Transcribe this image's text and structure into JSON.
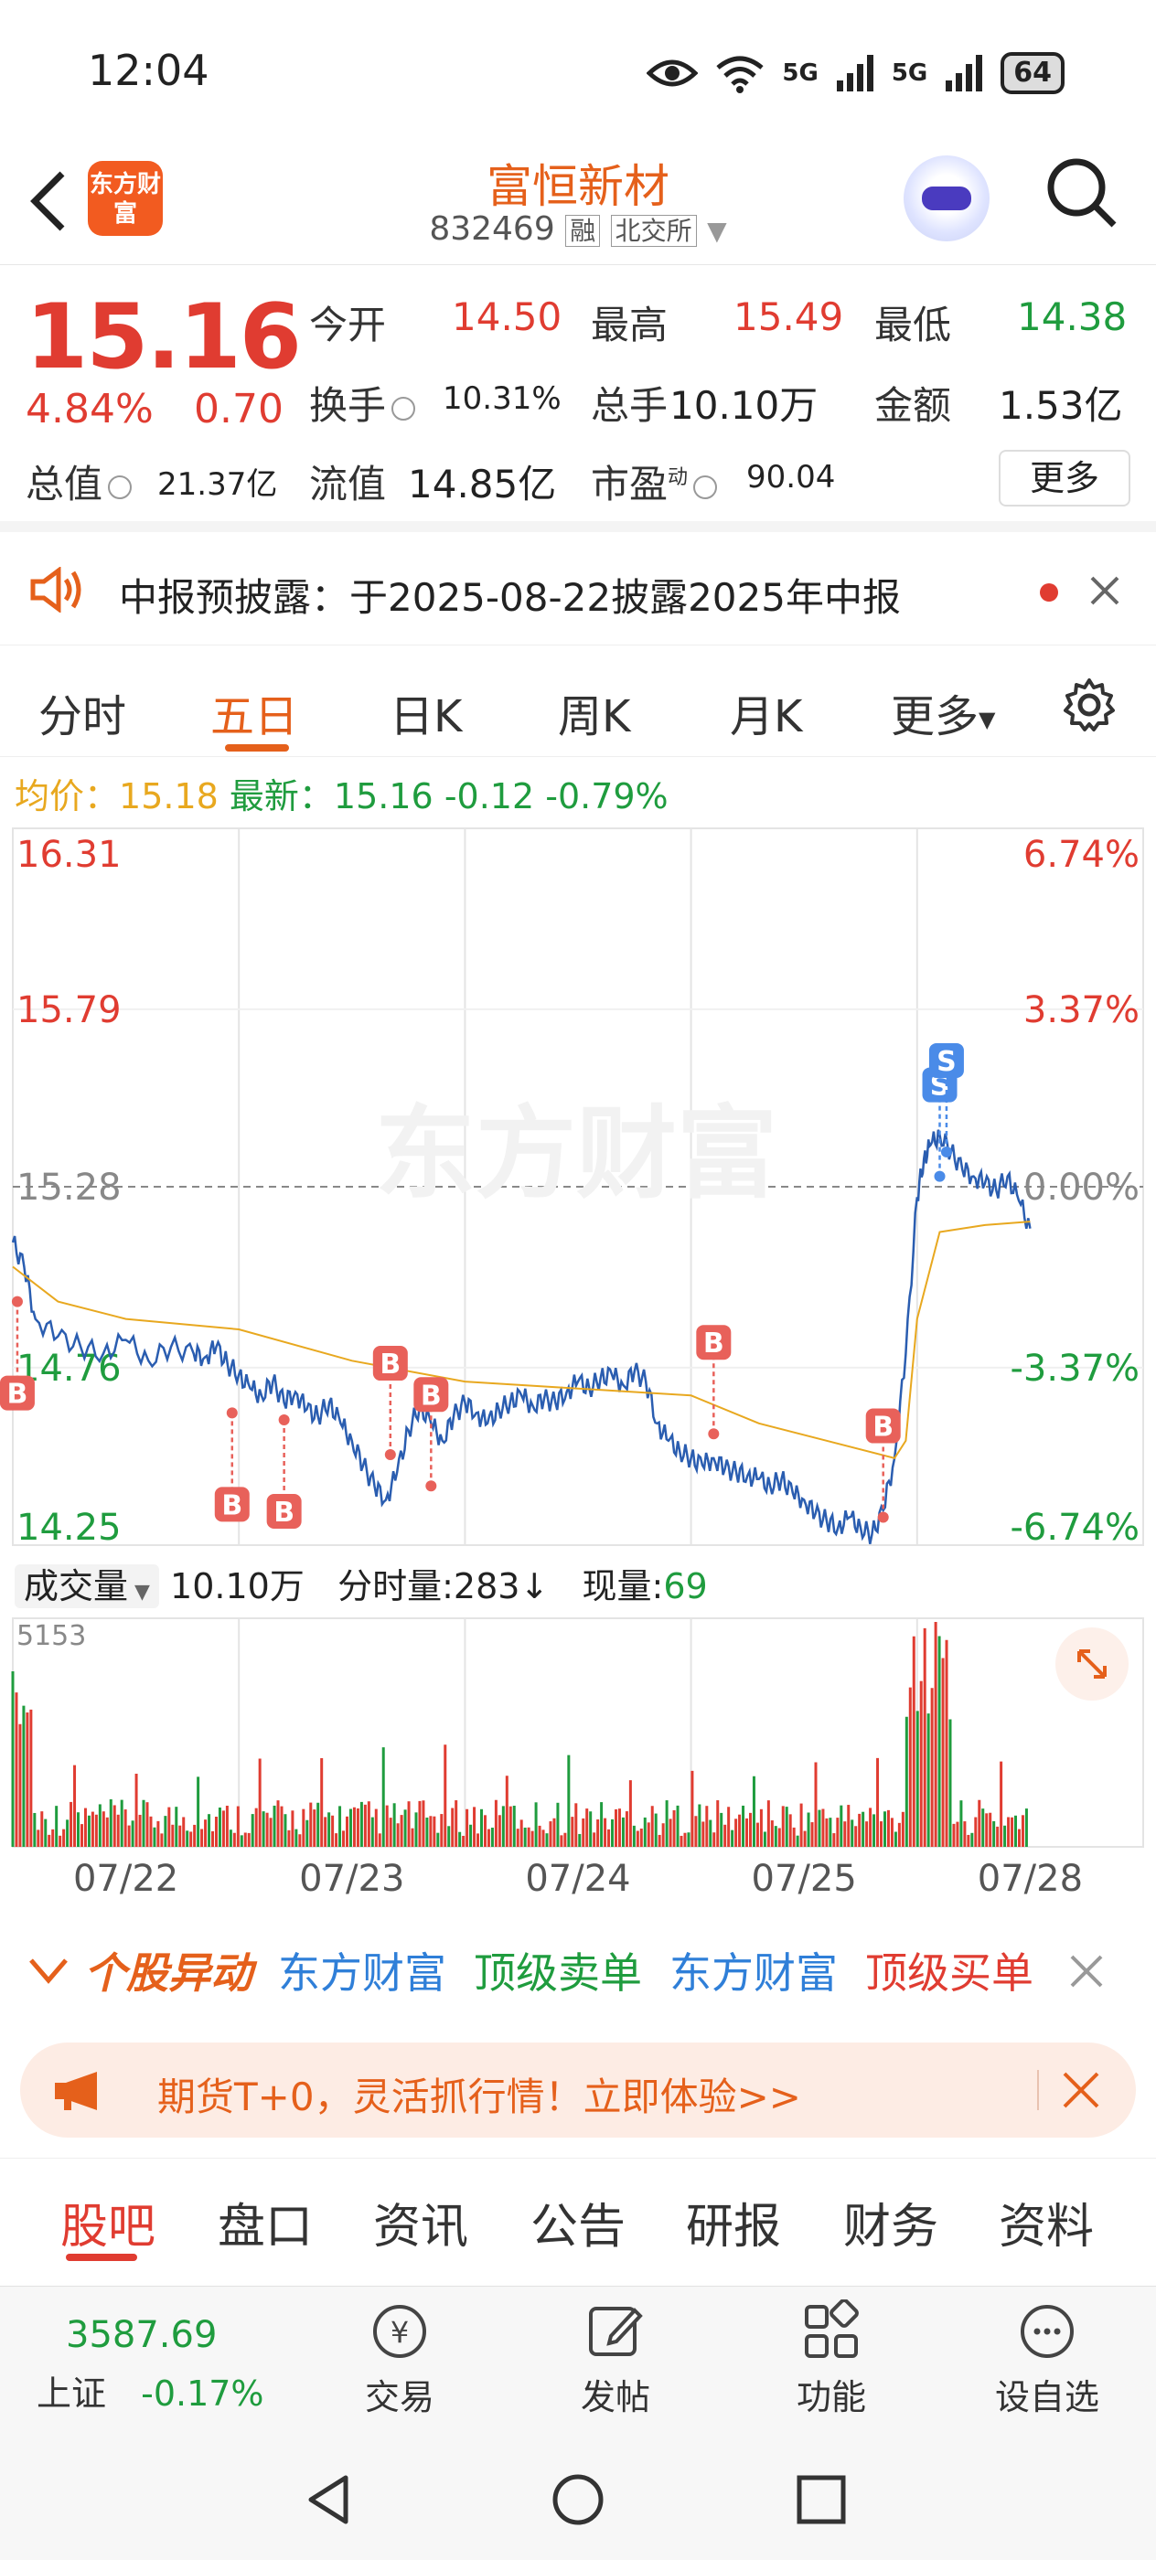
{
  "status_bar": {
    "time": "12:04",
    "network1": "5G",
    "network2": "5G",
    "battery": "64"
  },
  "header": {
    "logo_text": "东方财富",
    "title": "富恒新材",
    "code": "832469",
    "tag_margin": "融",
    "tag_exchange": "北交所"
  },
  "quote": {
    "price": "15.16",
    "change_pct": "4.84%",
    "change": "0.70",
    "open_label": "今开",
    "open": "14.50",
    "high_label": "最高",
    "high": "15.49",
    "low_label": "最低",
    "low": "14.38",
    "turnover_label": "换手",
    "turnover": "10.31%",
    "volume_label": "总手",
    "volume": "10.10万",
    "amount_label": "金额",
    "amount": "1.53亿",
    "mktcap_label": "总值",
    "mktcap": "21.37亿",
    "float_label": "流值",
    "float_cap": "14.85亿",
    "pe_label": "市盈",
    "pe_sup": "动",
    "pe": "90.04",
    "more": "更多"
  },
  "notice": {
    "text": "中报预披露：于2025-08-22披露2025年中报"
  },
  "chart_tabs": [
    "分时",
    "五日",
    "日K",
    "周K",
    "月K",
    "更多"
  ],
  "active_chart_tab": "五日",
  "avg_line": {
    "avg_label": "均价：",
    "avg": "15.18",
    "latest_label": "最新：",
    "latest": "15.16",
    "chg": "-0.12",
    "chg_pct": "-0.79%"
  },
  "chart_data": {
    "type": "line",
    "title": "",
    "y_left_ticks": [
      "16.31",
      "15.79",
      "15.28",
      "14.76",
      "14.25"
    ],
    "y_right_ticks": [
      "6.74%",
      "3.37%",
      "0.00%",
      "-3.37%",
      "-6.74%"
    ],
    "x_ticks": [
      "07/22",
      "07/23",
      "07/24",
      "07/25",
      "07/28"
    ],
    "ylim": [
      14.25,
      16.31
    ],
    "prev_close": 15.28,
    "watermark": "东方财富",
    "series": [
      {
        "name": "price",
        "color": "#2a5db0",
        "x": [
          0,
          0.05,
          0.1,
          0.2,
          0.3,
          0.4,
          0.5,
          0.6,
          0.7,
          0.8,
          0.85,
          0.9,
          0.95,
          1,
          1.05,
          1.1,
          1.15,
          1.2,
          1.25,
          1.3,
          1.35,
          1.4,
          1.45,
          1.5,
          1.55,
          1.6,
          1.65,
          1.7,
          1.75,
          1.8,
          1.85,
          1.9,
          1.95,
          2,
          2.05,
          2.1,
          2.15,
          2.2,
          2.25,
          2.3,
          2.35,
          2.4,
          2.45,
          2.5,
          2.55,
          2.6,
          2.65,
          2.7,
          2.75,
          2.8,
          2.85,
          2.9,
          2.95,
          3,
          3.05,
          3.1,
          3.15,
          3.2,
          3.25,
          3.3,
          3.35,
          3.4,
          3.45,
          3.5,
          3.55,
          3.6,
          3.65,
          3.7,
          3.75,
          3.8,
          3.85,
          3.9,
          3.95,
          4,
          4.03,
          4.06,
          4.1,
          4.15,
          4.2,
          4.25,
          4.3,
          4.35,
          4.4,
          4.45,
          4.5
        ],
        "values": [
          15.12,
          15.05,
          14.9,
          14.85,
          14.82,
          14.8,
          14.84,
          14.78,
          14.82,
          14.8,
          14.79,
          14.82,
          14.77,
          14.74,
          14.7,
          14.68,
          14.72,
          14.66,
          14.69,
          14.64,
          14.62,
          14.66,
          14.6,
          14.55,
          14.48,
          14.42,
          14.38,
          14.46,
          14.58,
          14.65,
          14.6,
          14.55,
          14.62,
          14.66,
          14.63,
          14.6,
          14.64,
          14.66,
          14.68,
          14.65,
          14.67,
          14.66,
          14.69,
          14.72,
          14.7,
          14.73,
          14.74,
          14.71,
          14.75,
          14.72,
          14.6,
          14.55,
          14.52,
          14.5,
          14.48,
          14.5,
          14.47,
          14.46,
          14.45,
          14.44,
          14.42,
          14.44,
          14.4,
          14.38,
          14.34,
          14.32,
          14.3,
          14.33,
          14.3,
          14.28,
          14.35,
          14.5,
          14.8,
          15.25,
          15.36,
          15.4,
          15.43,
          15.38,
          15.33,
          15.31,
          15.29,
          15.27,
          15.31,
          15.24,
          15.16
        ]
      },
      {
        "name": "avg",
        "color": "#e8a81f",
        "x": [
          0,
          0.2,
          0.5,
          1,
          1.5,
          2,
          2.5,
          3,
          3.3,
          3.6,
          3.9,
          3.95,
          4,
          4.1,
          4.3,
          4.5
        ],
        "values": [
          15.05,
          14.95,
          14.9,
          14.87,
          14.78,
          14.72,
          14.7,
          14.68,
          14.6,
          14.55,
          14.5,
          14.55,
          14.9,
          15.15,
          15.17,
          15.18
        ]
      }
    ],
    "trade_marks": [
      {
        "label": "B",
        "x": 0.02,
        "value": 14.95,
        "pos": "below"
      },
      {
        "label": "B",
        "x": 0.97,
        "value": 14.63,
        "pos": "below"
      },
      {
        "label": "B",
        "x": 1.2,
        "value": 14.61,
        "pos": "below"
      },
      {
        "label": "B",
        "x": 1.67,
        "value": 14.51,
        "pos": "above"
      },
      {
        "label": "B",
        "x": 1.85,
        "value": 14.42,
        "pos": "above"
      },
      {
        "label": "B",
        "x": 3.1,
        "value": 14.57,
        "pos": "above"
      },
      {
        "label": "B",
        "x": 3.85,
        "value": 14.33,
        "pos": "above"
      },
      {
        "label": "S",
        "x": 4.1,
        "value": 15.31,
        "pos": "above"
      },
      {
        "label": "S",
        "x": 4.13,
        "value": 15.38,
        "pos": "above"
      }
    ]
  },
  "volume": {
    "selector": "成交量",
    "total": "10.10万",
    "tick_label": "分时量:",
    "tick_vol": "283",
    "current_label": "现量:",
    "current": "69",
    "max": "5153"
  },
  "alert": {
    "title": "个股异动",
    "items": [
      {
        "text": "东方财富",
        "color": "#2f7fd8"
      },
      {
        "text": "顶级卖单",
        "color": "#1f9c3e"
      },
      {
        "text": "东方财富",
        "color": "#2f7fd8"
      },
      {
        "text": "顶级买单",
        "color": "#e03c31"
      }
    ]
  },
  "promo": {
    "text": "期货T+0，灵活抓行情！立即体验>>"
  },
  "bottom_tabs": [
    "股吧",
    "盘口",
    "资讯",
    "公告",
    "研报",
    "财务",
    "资料"
  ],
  "dock": {
    "index_value": "3587.69",
    "index_name": "上证",
    "index_chg": "-0.17%",
    "trade": "交易",
    "post": "发帖",
    "func": "功能",
    "watch": "设自选"
  }
}
